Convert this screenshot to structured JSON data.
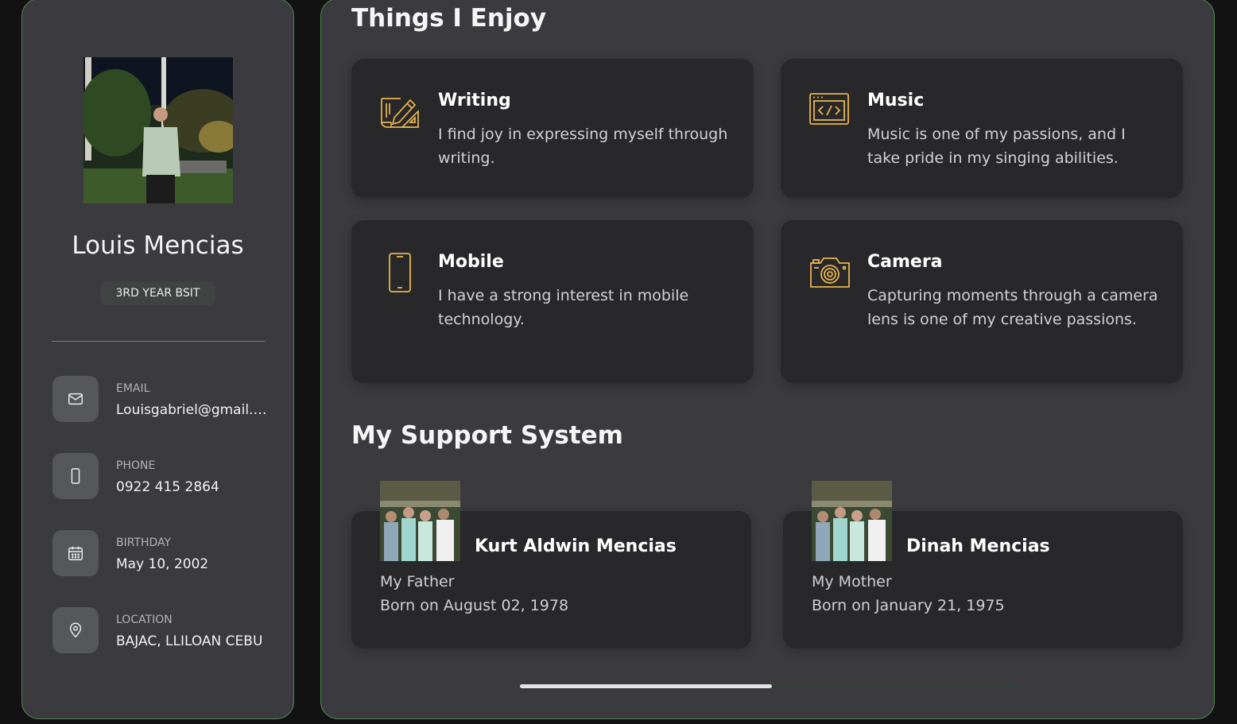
{
  "profile": {
    "name": "Louis Mencias",
    "title": "3RD YEAR BSIT"
  },
  "contacts": [
    {
      "label": "EMAIL",
      "value": "Louisgabriel@gmail.com",
      "icon": "mail-icon"
    },
    {
      "label": "PHONE",
      "value": "0922 415 2864",
      "icon": "phone-icon"
    },
    {
      "label": "BIRTHDAY",
      "value": "May 10, 2002",
      "icon": "calendar-icon"
    },
    {
      "label": "LOCATION",
      "value": "BAJAC, LLILOAN CEBU",
      "icon": "location-pin-icon"
    }
  ],
  "enjoy": {
    "heading": "Things I Enjoy",
    "items": [
      {
        "title": "Writing",
        "text": "I find joy in expressing myself through writing.",
        "icon": "design-pencil-icon"
      },
      {
        "title": "Music",
        "text": "Music is one of my passions, and I take pride in my singing abilities.",
        "icon": "code-window-icon"
      },
      {
        "title": "Mobile",
        "text": "I have a strong interest in mobile technology.",
        "icon": "smartphone-icon"
      },
      {
        "title": "Camera",
        "text": "Capturing moments through a camera lens is one of my creative passions.",
        "icon": "camera-icon"
      }
    ]
  },
  "support": {
    "heading": "My Support System",
    "people": [
      {
        "name": "Kurt Aldwin Mencias",
        "role": "My Father",
        "born": "Born on August 02, 1978"
      },
      {
        "name": "Dinah Mencias",
        "role": "My Mother",
        "born": "Born on January 21, 1975"
      }
    ]
  },
  "theme": {
    "accent": "#e8b44d",
    "border": "#4e8a4e",
    "panel": "#3b3b3f",
    "card": "#28282a"
  }
}
